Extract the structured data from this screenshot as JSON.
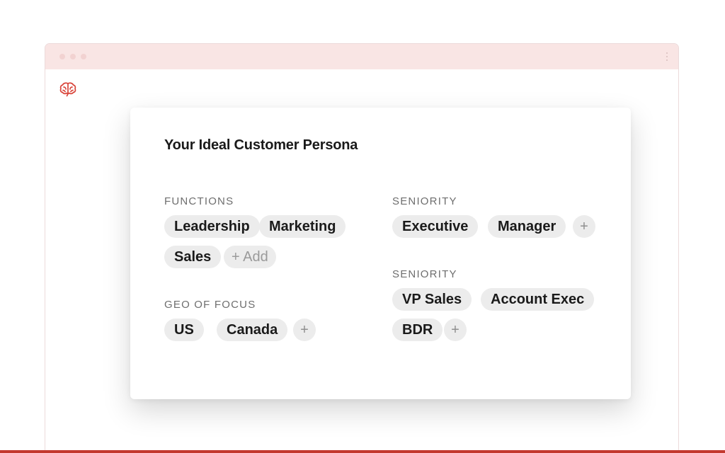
{
  "app": {
    "logo_icon": "brain-icon",
    "brand_color": "#c3392f"
  },
  "window": {
    "menu_icon": "vertical-dots-icon"
  },
  "card": {
    "title": "Your Ideal Customer Persona",
    "sections": {
      "functions": {
        "label": "FUNCTIONS",
        "tags": [
          "Leadership",
          "Marketing",
          "Sales"
        ],
        "add_label": "+ Add"
      },
      "geo": {
        "label": "GEO OF FOCUS",
        "tags": [
          "US",
          "Canada"
        ],
        "add_label": "+"
      },
      "seniority_1": {
        "label": "SENIORITY",
        "tags": [
          "Executive",
          "Manager"
        ],
        "add_label": "+"
      },
      "seniority_2": {
        "label": "SENIORITY",
        "tags": [
          "VP Sales",
          "Account Exec",
          "BDR"
        ],
        "add_label": "+"
      }
    }
  }
}
